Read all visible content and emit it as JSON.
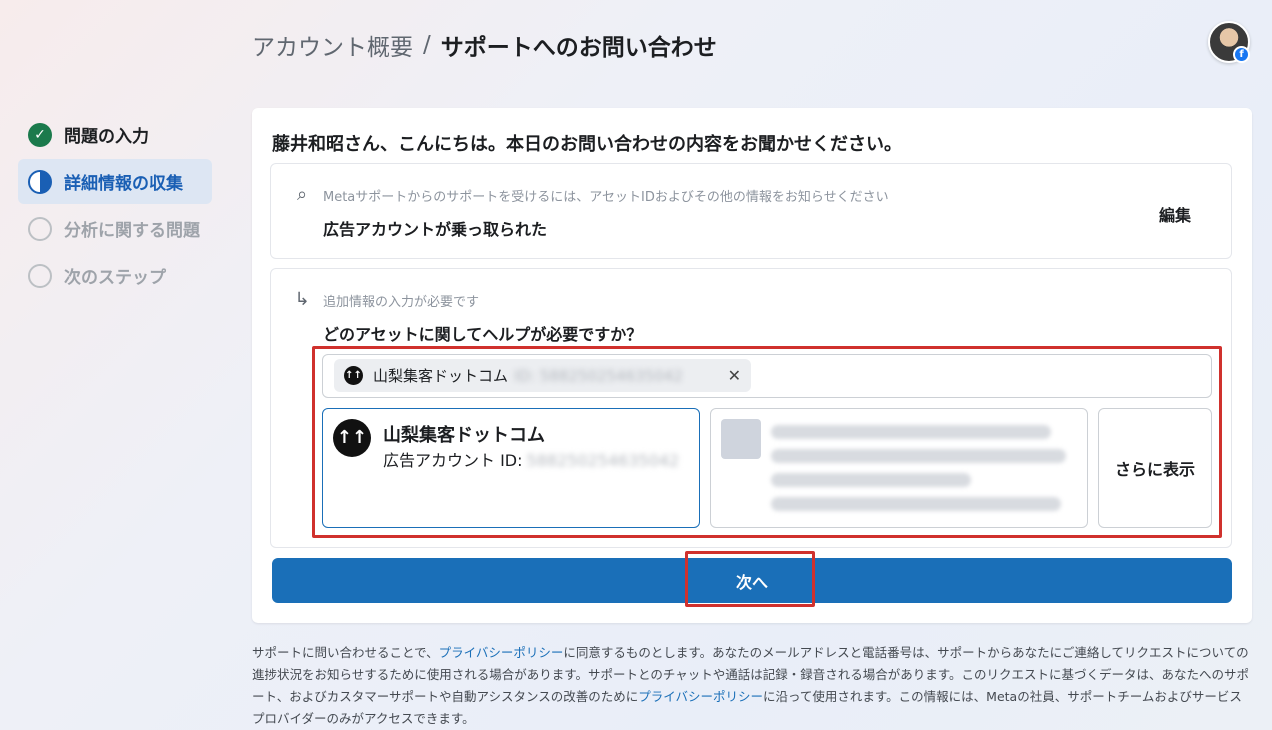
{
  "breadcrumb": {
    "parent": "アカウント概要",
    "separator": "/",
    "current": "サポートへのお問い合わせ"
  },
  "profile": {
    "badge": "f"
  },
  "steps": [
    {
      "label": "問題の入力",
      "state": "done"
    },
    {
      "label": "詳細情報の収集",
      "state": "active"
    },
    {
      "label": "分析に関する問題",
      "state": "todo"
    },
    {
      "label": "次のステップ",
      "state": "todo"
    }
  ],
  "main": {
    "greeting": "藤井和昭さん、こんにちは。本日のお問い合わせの内容をお聞かせください。",
    "issue_panel": {
      "hint": "Metaサポートからのサポートを受けるには、アセットIDおよびその他の情報をお知らせください",
      "value": "広告アカウントが乗っ取られた",
      "edit_label": "編集"
    },
    "asset_panel": {
      "hint": "追加情報の入力が必要です",
      "question": "どのアセットに関してヘルプが必要ですか？",
      "selected_chip": {
        "name": "山梨集客ドットコム",
        "id": "ID: 588250254635042"
      },
      "asset_option": {
        "name": "山梨集客ドットコム",
        "sub_label": "広告アカウント ID:",
        "sub_id": "588250254635042"
      },
      "more_label": "さらに表示"
    },
    "next_label": "次へ"
  },
  "footer": {
    "part1": "サポートに問い合わせることで、",
    "link1": "プライバシーポリシー",
    "part2": "に同意するものとします。あなたのメールアドレスと電話番号は、サポートからあなたにご連絡してリクエストについての進捗状況をお知らせするために使用される場合があります。サポートとのチャットや通話は記録・録音される場合があります。このリクエストに基づくデータは、あなたへのサポート、およびカスタマーサポートや自動アシスタンスの改善のために",
    "link2": "プライバシーポリシー",
    "part3": "に沿って使用されます。この情報には、Metaの社員、サポートチームおよびサービスプロバイダーのみがアクセスできます。"
  },
  "colors": {
    "accent": "#1a6fb8",
    "highlight_red": "#d0312d",
    "done_green": "#1b7a4c"
  }
}
